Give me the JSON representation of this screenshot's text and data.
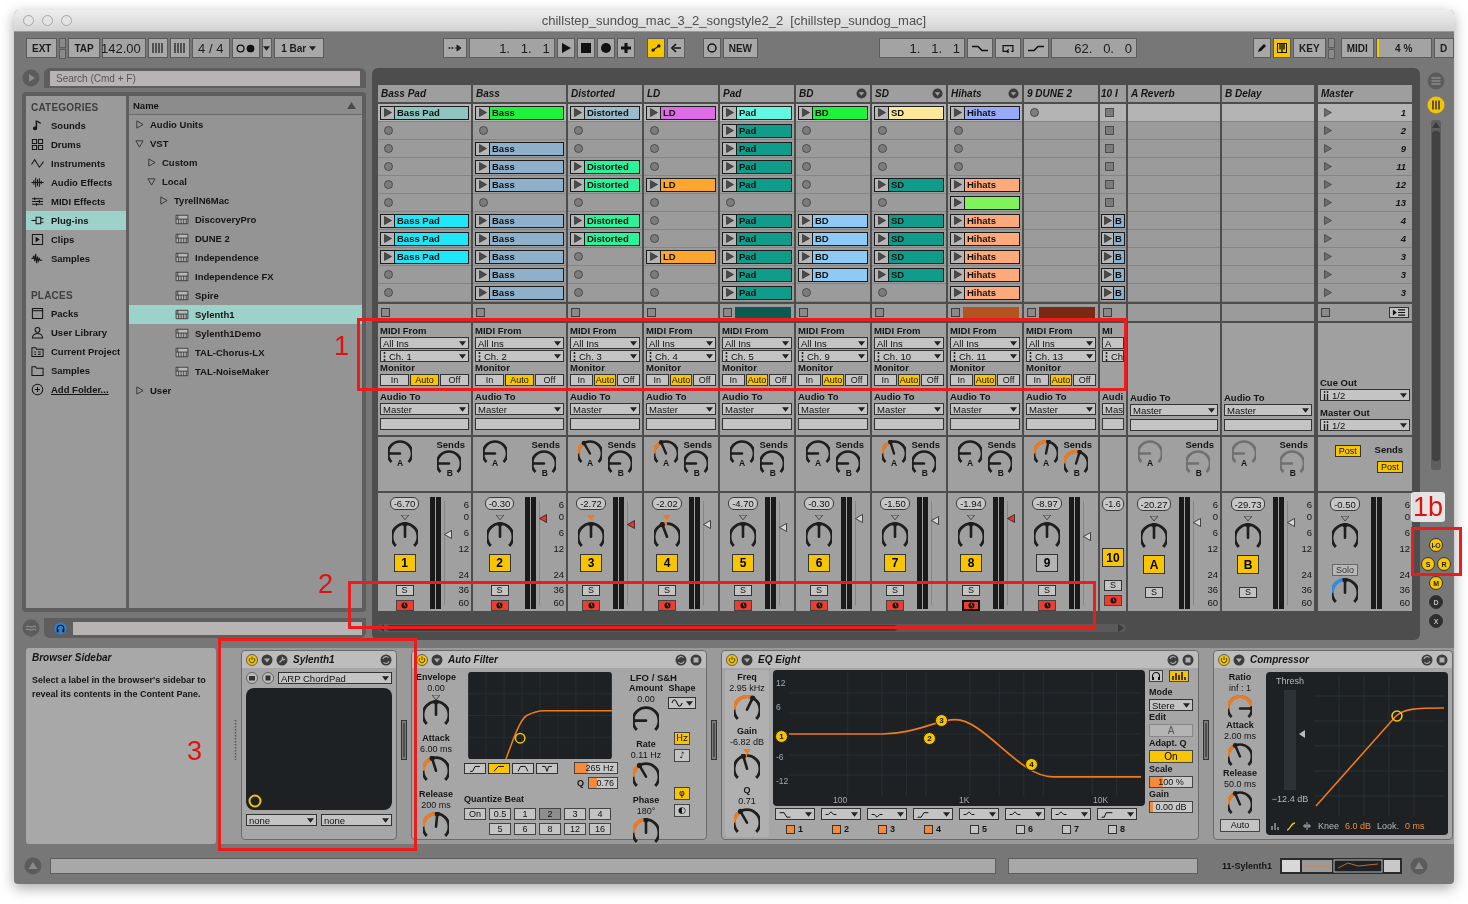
{
  "window": {
    "title": "chillstep_sundog_mac_3_2_songstyle2_2  [chillstep_sundog_mac]"
  },
  "toolbar": {
    "ext": "EXT",
    "tap": "TAP",
    "tempo": "142.00",
    "signature": "4 / 4",
    "quantize": "1 Bar",
    "position": "1.   1.   1",
    "automation_arm": true,
    "new": "NEW",
    "loop_start": "1.   1.   1",
    "loop_length": "62.   0.   0",
    "draw_mode": false,
    "midi_keyboard": true,
    "key": "KEY",
    "midi": "MIDI",
    "cpu": "4 %",
    "cpu_load": {
      "level": 0.04
    },
    "disk": "D"
  },
  "browser": {
    "search": {
      "placeholder": "Search (Cmd + F)"
    },
    "categories_heading": "CATEGORIES",
    "categories": [
      {
        "label": "Sounds",
        "selected": false
      },
      {
        "label": "Drums",
        "selected": false
      },
      {
        "label": "Instruments",
        "selected": false
      },
      {
        "label": "Audio Effects",
        "selected": false
      },
      {
        "label": "MIDI Effects",
        "selected": false
      },
      {
        "label": "Plug-ins",
        "selected": true
      },
      {
        "label": "Clips",
        "selected": false
      },
      {
        "label": "Samples",
        "selected": false
      }
    ],
    "places_heading": "PLACES",
    "places": [
      {
        "label": "Packs",
        "kind": "place",
        "selected": false
      },
      {
        "label": "User Library",
        "kind": "place",
        "selected": false
      },
      {
        "label": "Current Project",
        "kind": "place",
        "selected": false
      },
      {
        "label": "Samples",
        "kind": "place",
        "selected": false
      },
      {
        "label": "Add Folder...",
        "kind": "action",
        "selected": false
      }
    ],
    "name_column": "Name",
    "tree": [
      {
        "label": "Audio Units",
        "kind": "folder",
        "expanded": false,
        "selected": false
      },
      {
        "label": "VST",
        "kind": "folder",
        "expanded": true,
        "selected": false,
        "children": [
          {
            "label": "Custom",
            "kind": "folder",
            "expanded": false,
            "selected": false
          },
          {
            "label": "Local",
            "kind": "folder",
            "expanded": true,
            "selected": false,
            "children": [
              {
                "label": "TyrellN6Mac",
                "kind": "folder",
                "expanded": false,
                "selected": false
              },
              {
                "label": "DiscoveryPro",
                "kind": "plugin",
                "selected": false
              },
              {
                "label": "DUNE 2",
                "kind": "plugin",
                "selected": false
              },
              {
                "label": "Independence",
                "kind": "plugin",
                "selected": false
              },
              {
                "label": "Independence FX",
                "kind": "plugin",
                "selected": false
              },
              {
                "label": "Spire",
                "kind": "plugin",
                "selected": false
              },
              {
                "label": "Sylenth1",
                "kind": "plugin",
                "selected": true
              },
              {
                "label": "Sylenth1Demo",
                "kind": "plugin",
                "selected": false
              },
              {
                "label": "TAL-Chorus-LX",
                "kind": "plugin",
                "selected": false
              },
              {
                "label": "TAL-NoiseMaker",
                "kind": "plugin",
                "selected": false
              }
            ]
          }
        ]
      },
      {
        "label": "User",
        "kind": "folder",
        "expanded": false,
        "selected": false
      }
    ]
  },
  "session": {
    "tracks": [
      {
        "name": "Bass Pad",
        "kind": "midi",
        "fold_button": false,
        "clips": [
          {
            "kind": "clip",
            "name": "Bass Pad",
            "color": "#8ec5be"
          },
          {
            "kind": "button"
          },
          {
            "kind": "button"
          },
          {
            "kind": "button"
          },
          {
            "kind": "button"
          },
          {
            "kind": "button"
          },
          {
            "kind": "clip",
            "name": "Bass Pad",
            "color": "#1ee7f8"
          },
          {
            "kind": "clip",
            "name": "Bass Pad",
            "color": "#1ee7f8"
          },
          {
            "kind": "clip",
            "name": "Bass Pad",
            "color": "#1ee7f8"
          },
          {
            "kind": "button"
          },
          {
            "kind": "button"
          }
        ],
        "midi_from_label": "MIDI From",
        "midi_from": "All Ins",
        "channel": "Ch. 1",
        "monitor_label": "Monitor",
        "monitor": [
          {
            "label": "In",
            "selected": false
          },
          {
            "label": "Auto",
            "selected": true
          },
          {
            "label": "Off",
            "selected": false
          }
        ],
        "audio_to_label": "Audio To",
        "audio_to": "Master",
        "sends_label": "Sends",
        "sends": [
          {
            "label": "A",
            "level": 0
          },
          {
            "label": "B",
            "level": 0
          }
        ],
        "volume": "-6.70",
        "pan": {
          "level": 0.5,
          "highlighted": false
        },
        "fader": {
          "level": 0.68,
          "peak": false
        },
        "number": "1",
        "active": true,
        "solo": "S",
        "arm": true,
        "arm_focus": false,
        "scale": [
          "6",
          "0",
          "6",
          "12",
          "24",
          "36",
          "60"
        ]
      },
      {
        "name": "Bass",
        "kind": "midi",
        "fold_button": false,
        "clips": [
          {
            "kind": "clip",
            "name": "Bass",
            "color": "#1ff23b"
          },
          {
            "kind": "button"
          },
          {
            "kind": "clip",
            "name": "Bass",
            "color": "#8eb0cb"
          },
          {
            "kind": "clip",
            "name": "Bass",
            "color": "#8eb0cb"
          },
          {
            "kind": "clip",
            "name": "Bass",
            "color": "#8eb0cb"
          },
          {
            "kind": "button"
          },
          {
            "kind": "clip",
            "name": "Bass",
            "color": "#8eb0cb"
          },
          {
            "kind": "clip",
            "name": "Bass",
            "color": "#8eb0cb"
          },
          {
            "kind": "clip",
            "name": "Bass",
            "color": "#8eb0cb"
          },
          {
            "kind": "clip",
            "name": "Bass",
            "color": "#8eb0cb"
          },
          {
            "kind": "clip",
            "name": "Bass",
            "color": "#8eb0cb"
          }
        ],
        "midi_from_label": "MIDI From",
        "midi_from": "All Ins",
        "channel": "Ch. 2",
        "monitor_label": "Monitor",
        "monitor": [
          {
            "label": "In",
            "selected": false
          },
          {
            "label": "Auto",
            "selected": true
          },
          {
            "label": "Off",
            "selected": false
          }
        ],
        "audio_to_label": "Audio To",
        "audio_to": "Master",
        "sends_label": "Sends",
        "sends": [
          {
            "label": "A",
            "level": 0
          },
          {
            "label": "B",
            "level": 0
          }
        ],
        "volume": "-0.30",
        "pan": {
          "level": 0.5,
          "highlighted": false
        },
        "fader": {
          "level": 0.84,
          "peak": true
        },
        "number": "2",
        "active": true,
        "solo": "S",
        "arm": true,
        "arm_focus": false,
        "scale": [
          "6",
          "0",
          "6",
          "12",
          "24",
          "36",
          "60"
        ]
      },
      {
        "name": "Distorted",
        "kind": "midi",
        "fold_button": false,
        "clips": [
          {
            "kind": "clip",
            "name": "Distorted",
            "color": "#9dbccb"
          },
          {
            "kind": "button"
          },
          {
            "kind": "button"
          },
          {
            "kind": "clip",
            "name": "Distorted",
            "color": "#2cf29b"
          },
          {
            "kind": "clip",
            "name": "Distorted",
            "color": "#2cf29b"
          },
          {
            "kind": "button"
          },
          {
            "kind": "clip",
            "name": "Distorted",
            "color": "#2cf29b"
          },
          {
            "kind": "clip",
            "name": "Distorted",
            "color": "#2cf29b"
          },
          {
            "kind": "button"
          },
          {
            "kind": "button"
          },
          {
            "kind": "button"
          }
        ],
        "midi_from_label": "MIDI From",
        "midi_from": "All Ins",
        "channel": "Ch. 3",
        "monitor_label": "Monitor",
        "monitor": [
          {
            "label": "In",
            "selected": false
          },
          {
            "label": "Auto",
            "selected": true
          },
          {
            "label": "Off",
            "selected": false
          }
        ],
        "audio_to_label": "Audio To",
        "audio_to": "Master",
        "sends_label": "Sends",
        "sends": [
          {
            "label": "A",
            "level": 0.25
          },
          {
            "label": "B",
            "level": 0
          }
        ],
        "volume": "-2.72",
        "pan": {
          "level": 0.5,
          "highlighted": true
        },
        "fader": {
          "level": 0.78,
          "peak": true
        },
        "number": "3",
        "active": true,
        "solo": "S",
        "arm": true,
        "arm_focus": false
      },
      {
        "name": "LD",
        "kind": "midi",
        "fold_button": false,
        "clips": [
          {
            "kind": "clip",
            "name": "LD",
            "color": "#dd6ce6"
          },
          {
            "kind": "button"
          },
          {
            "kind": "button"
          },
          {
            "kind": "button"
          },
          {
            "kind": "clip",
            "name": "LD",
            "color": "#fca62f"
          },
          {
            "kind": "button"
          },
          {
            "kind": "button"
          },
          {
            "kind": "button"
          },
          {
            "kind": "clip",
            "name": "LD",
            "color": "#fca62f"
          },
          {
            "kind": "button"
          },
          {
            "kind": "button"
          }
        ],
        "midi_from_label": "MIDI From",
        "midi_from": "All Ins",
        "channel": "Ch. 4",
        "monitor_label": "Monitor",
        "monitor": [
          {
            "label": "In",
            "selected": false
          },
          {
            "label": "Auto",
            "selected": true
          },
          {
            "label": "Off",
            "selected": false
          }
        ],
        "audio_to_label": "Audio To",
        "audio_to": "Master",
        "sends_label": "Sends",
        "sends": [
          {
            "label": "A",
            "level": 0.3
          },
          {
            "label": "B",
            "level": 0
          }
        ],
        "volume": "-2.02",
        "pan": {
          "level": 0.32,
          "highlighted": true
        },
        "fader": {
          "level": 0.78,
          "peak": false
        },
        "number": "4",
        "active": true,
        "solo": "S",
        "arm": true,
        "arm_focus": false
      },
      {
        "name": "Pad",
        "kind": "midi",
        "fold_button": false,
        "clips": [
          {
            "kind": "clip",
            "name": "Pad",
            "color": "#62f7e3"
          },
          {
            "kind": "clip",
            "name": "Pad",
            "color": "#0f9c8b"
          },
          {
            "kind": "clip",
            "name": "Pad",
            "color": "#0f9c8b"
          },
          {
            "kind": "clip",
            "name": "Pad",
            "color": "#0f9c8b"
          },
          {
            "kind": "clip",
            "name": "Pad",
            "color": "#0f9c8b"
          },
          {
            "kind": "button"
          },
          {
            "kind": "clip",
            "name": "Pad",
            "color": "#0f9c8b"
          },
          {
            "kind": "clip",
            "name": "Pad",
            "color": "#0f9c8b"
          },
          {
            "kind": "clip",
            "name": "Pad",
            "color": "#0f9c8b"
          },
          {
            "kind": "clip",
            "name": "Pad",
            "color": "#0f9c8b"
          },
          {
            "kind": "clip",
            "name": "Pad",
            "color": "#0f9c8b"
          }
        ],
        "status": {
          "color": "#0c5a50"
        },
        "midi_from_label": "MIDI From",
        "midi_from": "All Ins",
        "channel": "Ch. 5",
        "monitor_label": "Monitor",
        "monitor": [
          {
            "label": "In",
            "selected": false
          },
          {
            "label": "Auto",
            "selected": true
          },
          {
            "label": "Off",
            "selected": false
          }
        ],
        "audio_to_label": "Audio To",
        "audio_to": "Master",
        "sends_label": "Sends",
        "sends": [
          {
            "label": "A",
            "level": 0
          },
          {
            "label": "B",
            "level": 0
          }
        ],
        "volume": "-4.70",
        "pan": {
          "level": 0.5,
          "highlighted": false
        },
        "fader": {
          "level": 0.75,
          "peak": false
        },
        "number": "5",
        "active": true,
        "solo": "S",
        "arm": true,
        "arm_focus": false
      },
      {
        "name": "BD",
        "kind": "midi",
        "fold_button": true,
        "clips": [
          {
            "kind": "clip",
            "name": "BD",
            "color": "#1ff23b"
          },
          {
            "kind": "button"
          },
          {
            "kind": "button"
          },
          {
            "kind": "button"
          },
          {
            "kind": "button"
          },
          {
            "kind": "button"
          },
          {
            "kind": "clip",
            "name": "BD",
            "color": "#8fcaf7"
          },
          {
            "kind": "clip",
            "name": "BD",
            "color": "#8fcaf7"
          },
          {
            "kind": "clip",
            "name": "BD",
            "color": "#8fcaf7"
          },
          {
            "kind": "clip",
            "name": "BD",
            "color": "#8fcaf7"
          },
          {
            "kind": "button"
          }
        ],
        "midi_from_label": "MIDI From",
        "midi_from": "All Ins",
        "channel": "Ch. 9",
        "monitor_label": "Monitor",
        "monitor": [
          {
            "label": "In",
            "selected": false
          },
          {
            "label": "Auto",
            "selected": true
          },
          {
            "label": "Off",
            "selected": false
          }
        ],
        "audio_to_label": "Audio To",
        "audio_to": "Master",
        "sends_label": "Sends",
        "sends": [
          {
            "label": "A",
            "level": 0
          },
          {
            "label": "B",
            "level": 0
          }
        ],
        "volume": "-0.30",
        "pan": {
          "level": 0.5,
          "highlighted": false
        },
        "fader": {
          "level": 0.84,
          "peak": false
        },
        "number": "6",
        "active": true,
        "solo": "S",
        "arm": true,
        "arm_focus": false
      },
      {
        "name": "SD",
        "kind": "midi",
        "fold_button": true,
        "clips": [
          {
            "kind": "clip",
            "name": "SD",
            "color": "#fde89a"
          },
          {
            "kind": "button"
          },
          {
            "kind": "button"
          },
          {
            "kind": "button"
          },
          {
            "kind": "clip",
            "name": "SD",
            "color": "#0f9c8b"
          },
          {
            "kind": "button"
          },
          {
            "kind": "clip",
            "name": "SD",
            "color": "#0f9c8b"
          },
          {
            "kind": "clip",
            "name": "SD",
            "color": "#0f9c8b"
          },
          {
            "kind": "clip",
            "name": "SD",
            "color": "#0f9c8b"
          },
          {
            "kind": "clip",
            "name": "SD",
            "color": "#0f9c8b"
          },
          {
            "kind": "button"
          }
        ],
        "midi_from_label": "MIDI From",
        "midi_from": "All Ins",
        "channel": "Ch. 10",
        "monitor_label": "Monitor",
        "monitor": [
          {
            "label": "In",
            "selected": false
          },
          {
            "label": "Auto",
            "selected": true
          },
          {
            "label": "Off",
            "selected": false
          }
        ],
        "audio_to_label": "Audio To",
        "audio_to": "Master",
        "sends_label": "Sends",
        "sends": [
          {
            "label": "A",
            "level": 0.35
          },
          {
            "label": "B",
            "level": 0
          }
        ],
        "volume": "-1.50",
        "pan": {
          "level": 0.5,
          "highlighted": false
        },
        "fader": {
          "level": 0.82,
          "peak": false
        },
        "number": "7",
        "active": true,
        "solo": "S",
        "arm": true,
        "arm_focus": false
      },
      {
        "name": "Hihats",
        "kind": "midi",
        "fold_button": true,
        "clips": [
          {
            "kind": "clip",
            "name": "Hihats",
            "color": "#97a9f7"
          },
          {
            "kind": "button"
          },
          {
            "kind": "button"
          },
          {
            "kind": "button"
          },
          {
            "kind": "clip",
            "name": "Hihats",
            "color": "#fcaa7c"
          },
          {
            "kind": "clip",
            "color": "#80f25c"
          },
          {
            "kind": "clip",
            "name": "Hihats",
            "color": "#fcaa7c"
          },
          {
            "kind": "clip",
            "name": "Hihats",
            "color": "#fcaa7c"
          },
          {
            "kind": "clip",
            "name": "Hihats",
            "color": "#fcaa7c"
          },
          {
            "kind": "clip",
            "name": "Hihats",
            "color": "#fcaa7c"
          },
          {
            "kind": "clip",
            "name": "Hihats",
            "color": "#fcaa7c"
          }
        ],
        "status": {
          "color": "#b5521f"
        },
        "midi_from_label": "MIDI From",
        "midi_from": "All Ins",
        "channel": "Ch. 11",
        "monitor_label": "Monitor",
        "monitor": [
          {
            "label": "In",
            "selected": false
          },
          {
            "label": "Auto",
            "selected": true
          },
          {
            "label": "Off",
            "selected": false
          }
        ],
        "audio_to_label": "Audio To",
        "audio_to": "Master",
        "sends_label": "Sends",
        "sends": [
          {
            "label": "A",
            "level": 0
          },
          {
            "label": "B",
            "level": 0
          }
        ],
        "volume": "-1.94",
        "pan": {
          "level": 0.5,
          "highlighted": false
        },
        "fader": {
          "level": 0.84,
          "peak": true
        },
        "number": "8",
        "active": true,
        "solo": "S",
        "arm": true,
        "arm_focus": true
      },
      {
        "name": "9 DUNE 2",
        "kind": "midi",
        "fold_button": false,
        "clips": [
          {
            "kind": "button"
          },
          {
            "kind": "none"
          },
          {
            "kind": "none"
          },
          {
            "kind": "none"
          },
          {
            "kind": "none"
          },
          {
            "kind": "none"
          },
          {
            "kind": "none"
          },
          {
            "kind": "none"
          },
          {
            "kind": "none"
          },
          {
            "kind": "none"
          },
          {
            "kind": "none"
          }
        ],
        "status": {
          "color": "#7a2a12"
        },
        "midi_from_label": "MIDI From",
        "midi_from": "All Ins",
        "channel": "Ch. 13",
        "monitor_label": "Monitor",
        "monitor": [
          {
            "label": "In",
            "selected": false
          },
          {
            "label": "Auto",
            "selected": true
          },
          {
            "label": "Off",
            "selected": false
          }
        ],
        "audio_to_label": "Audio To",
        "audio_to": "Master",
        "sends_label": "Sends",
        "sends": [
          {
            "label": "A",
            "level": 0.6
          },
          {
            "label": "B",
            "level": 0.65
          }
        ],
        "volume": "-8.97",
        "pan": {
          "level": 0.5,
          "highlighted": false
        },
        "fader": {
          "level": 0.66,
          "peak": false
        },
        "number": "9",
        "active": false,
        "solo": "S",
        "arm": true,
        "arm_focus": false
      },
      {
        "name": "10 I",
        "kind": "partial",
        "fold_button": false,
        "clips": [
          {
            "kind": "square"
          },
          {
            "kind": "square"
          },
          {
            "kind": "square"
          },
          {
            "kind": "square"
          },
          {
            "kind": "square"
          },
          {
            "kind": "square"
          },
          {
            "kind": "clip",
            "name": "B",
            "color": "#8eb0cb"
          },
          {
            "kind": "clip",
            "name": "B",
            "color": "#8eb0cb"
          },
          {
            "kind": "clip",
            "name": "B",
            "color": "#8eb0cb"
          },
          {
            "kind": "clip",
            "name": "B",
            "color": "#8eb0cb"
          },
          {
            "kind": "clip",
            "name": "B",
            "color": "#8eb0cb"
          }
        ],
        "midi_from_label": "MI",
        "midi_from": "A",
        "channel": "Ch",
        "audio_to_label": "Audi",
        "audio_to": "Mas",
        "volume": "-1.6",
        "number": "10",
        "active": true,
        "solo": "S",
        "arm": true,
        "arm_focus": false
      }
    ],
    "returns": [
      {
        "name": "A Reverb",
        "audio_to_label": "Audio To",
        "audio_to": "Master",
        "sends_label": "Sends",
        "sends": [
          {
            "label": "A",
            "level": 0,
            "disabled": true
          },
          {
            "label": "B",
            "level": 0,
            "disabled": true
          }
        ],
        "volume": "-20.27",
        "pan": {
          "level": 0.5,
          "highlighted": false
        },
        "fader": {
          "level": 0.8,
          "peak": false
        },
        "number": "A",
        "active": true,
        "solo": "S",
        "scale": [
          "6",
          "0",
          "6",
          "12",
          "24",
          "36",
          "60"
        ]
      },
      {
        "name": "B Delay",
        "audio_to_label": "Audio To",
        "audio_to": "Master",
        "sends_label": "Sends",
        "sends": [
          {
            "label": "A",
            "level": 0,
            "disabled": true
          },
          {
            "label": "B",
            "level": 0,
            "disabled": true
          }
        ],
        "volume": "-29.73",
        "pan": {
          "level": 0.5,
          "highlighted": false
        },
        "fader": {
          "level": 0.8,
          "peak": false
        },
        "number": "B",
        "active": true,
        "solo": "S",
        "scale": [
          "6",
          "0",
          "6",
          "12",
          "24",
          "36",
          "60"
        ]
      }
    ],
    "master": {
      "name": "Master",
      "scenes": [
        {
          "label": "1",
          "selected": true
        },
        {
          "label": "2",
          "selected": false
        },
        {
          "label": "9",
          "selected": false
        },
        {
          "label": "11",
          "selected": false
        },
        {
          "label": "12",
          "selected": false
        },
        {
          "label": "13",
          "selected": false
        },
        {
          "label": "4",
          "selected": false
        },
        {
          "label": "4",
          "selected": false
        },
        {
          "label": "3",
          "selected": false
        },
        {
          "label": "3",
          "selected": false
        },
        {
          "label": "3",
          "selected": false
        }
      ],
      "cue_out_label": "Cue Out",
      "cue_out": "1/2",
      "master_out_label": "Master Out",
      "master_out": "1/2",
      "sends_label": "Sends",
      "post": [
        {
          "label": "Post",
          "on": true
        },
        {
          "label": "Post",
          "on": true
        }
      ],
      "volume": "-0.50",
      "pan": {
        "level": 0.5,
        "highlighted": false
      },
      "solo": "Solo",
      "cue": {
        "level": 0.5
      },
      "scale": [
        "6",
        "0",
        "6",
        "12",
        "24",
        "36",
        "60"
      ]
    },
    "view_toggles": [
      {
        "label": "I-O",
        "on": true
      },
      {
        "label": "S",
        "on": true
      },
      {
        "label": "R",
        "on": true
      },
      {
        "label": "M",
        "on": true
      },
      {
        "label": "D",
        "on": false
      },
      {
        "label": "X",
        "on": false
      }
    ]
  },
  "info": {
    "title": "Browser Sidebar",
    "text": "Select a label in the browser's sidebar to reveal its contents in the Content Pane."
  },
  "devices": [
    {
      "kind": "instrument",
      "name": "Sylenth1",
      "on": true,
      "preset": "ARP ChordPad",
      "x_param": "none",
      "y_param": "none"
    },
    {
      "kind": "auto-filter",
      "name": "Auto Filter",
      "on": true,
      "envelope_knobs": [
        {
          "label": "Envelope",
          "value": "0.00",
          "level": 0.5,
          "bipolar": true
        },
        {
          "label": "Attack",
          "value": "6.00 ms",
          "level": 0.35,
          "bipolar": false
        },
        {
          "label": "Release",
          "value": "200 ms",
          "level": 0.55,
          "bipolar": false
        }
      ],
      "filter_types": [
        {
          "selected": false
        },
        {
          "selected": true
        },
        {
          "selected": false
        },
        {
          "selected": false
        }
      ],
      "frequency": "265 Hz",
      "q_label": "Q",
      "q": "0.76",
      "quantize_label": "Quantize Beat",
      "quantize": [
        {
          "label": "On",
          "selected": false
        },
        {
          "label": "0.5",
          "selected": false
        },
        {
          "label": "1",
          "selected": false
        },
        {
          "label": "2",
          "selected": true
        },
        {
          "label": "3",
          "selected": false
        },
        {
          "label": "4",
          "selected": false
        },
        {
          "label": "5",
          "selected": false
        },
        {
          "label": "6",
          "selected": false
        },
        {
          "label": "8",
          "selected": false
        },
        {
          "label": "12",
          "selected": false
        },
        {
          "label": "16",
          "selected": false
        }
      ],
      "lfo_label": "LFO / S&H",
      "shape_label": "Shape",
      "lfo_knobs": [
        {
          "label": "Amount",
          "value": "0.00",
          "level": 0,
          "bipolar": false
        },
        {
          "label": "Rate",
          "value": "0.11 Hz",
          "level": 0.25,
          "bipolar": false
        },
        {
          "label": "Phase",
          "value": "180°",
          "level": 0.5,
          "bipolar": false
        }
      ],
      "rate_mode": [
        {
          "label": "Hz",
          "selected": true
        },
        {
          "label": "♪",
          "selected": false
        }
      ],
      "phase_mode": [
        {
          "label": "φ",
          "selected": true
        },
        {
          "label": "◐",
          "selected": false
        }
      ]
    },
    {
      "kind": "eq",
      "name": "EQ Eight",
      "on": true,
      "knobs": [
        {
          "label": "Freq",
          "value": "2.95 kHz",
          "level": 0.72,
          "bipolar": false
        },
        {
          "label": "Gain",
          "value": "-6.82 dB",
          "level": 0.36,
          "bipolar": true
        },
        {
          "label": "Q",
          "value": "0.71",
          "level": 0.25,
          "bipolar": false
        }
      ],
      "y_ticks": [
        "12",
        "6",
        "-6",
        "-12"
      ],
      "x_ticks": [
        "100",
        "1K",
        "10K"
      ],
      "points": [
        {
          "label": "1"
        },
        {
          "label": "2"
        },
        {
          "label": "3"
        },
        {
          "label": "4"
        }
      ],
      "bands": [
        {
          "label": "1",
          "on": true
        },
        {
          "label": "2",
          "on": true
        },
        {
          "label": "3",
          "on": true
        },
        {
          "label": "4",
          "on": true
        },
        {
          "label": "5",
          "on": false
        },
        {
          "label": "6",
          "on": false
        },
        {
          "label": "7",
          "on": false
        },
        {
          "label": "8",
          "on": false
        }
      ],
      "mode_label": "Mode",
      "mode": "Stere",
      "edit_label": "Edit",
      "edit": "A",
      "adapt_label": "Adapt. Q",
      "adapt": "On",
      "adapt_on": true,
      "scale_label": "Scale",
      "scale": "100 %",
      "gain_label": "Gain",
      "gain": "0.00 dB"
    },
    {
      "kind": "compressor",
      "name": "Compressor",
      "on": true,
      "knobs": [
        {
          "label": "Ratio",
          "value": "inf : 1",
          "level": 1,
          "bipolar": false
        },
        {
          "label": "Attack",
          "value": "2.00 ms",
          "level": 0.3,
          "bipolar": false
        },
        {
          "label": "Release",
          "value": "50.0 ms",
          "level": 0.3,
          "bipolar": false
        }
      ],
      "auto": "Auto",
      "auto_on": false,
      "thresh_label": "Thresh",
      "threshold_slider": {
        "level": 0.56
      },
      "threshold": "−12.4 dB",
      "knee_label": "Knee",
      "knee": "6.0 dB",
      "look_label": "Look.",
      "look": "0 ms"
    }
  ],
  "status_bar": {
    "track": "11-Sylenth1"
  },
  "annotations": [
    {
      "label": "1"
    },
    {
      "label": "1b"
    },
    {
      "label": "2"
    },
    {
      "label": "3"
    }
  ]
}
